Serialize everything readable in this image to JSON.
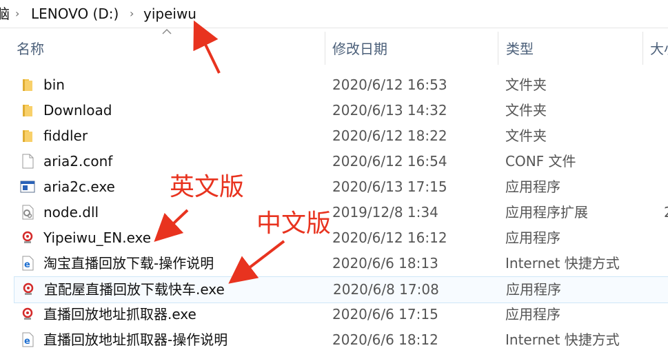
{
  "breadcrumb": {
    "items": [
      "脑",
      "LENOVO (D:)",
      "yipeiwu"
    ]
  },
  "columns": {
    "name": "名称",
    "modified": "修改日期",
    "type": "类型",
    "size": "大小"
  },
  "files": [
    {
      "name": "bin",
      "modified": "2020/6/12 16:53",
      "type": "文件夹",
      "icon": "folder-icon"
    },
    {
      "name": "Download",
      "modified": "2020/6/13 14:32",
      "type": "文件夹",
      "icon": "folder-icon"
    },
    {
      "name": "fiddler",
      "modified": "2020/6/12 18:22",
      "type": "文件夹",
      "icon": "folder-icon"
    },
    {
      "name": "aria2.conf",
      "modified": "2020/6/12 16:54",
      "type": "CONF 文件",
      "icon": "document-icon"
    },
    {
      "name": "aria2c.exe",
      "modified": "2020/6/13 17:15",
      "type": "应用程序",
      "icon": "app-window-icon"
    },
    {
      "name": "node.dll",
      "modified": "2019/12/8 1:34",
      "type": "应用程序扩展",
      "icon": "dll-gear-icon",
      "extra": "2"
    },
    {
      "name": "Yipeiwu_EN.exe",
      "modified": "2020/6/12 16:12",
      "type": "应用程序",
      "icon": "red-app-icon"
    },
    {
      "name": "淘宝直播回放下载-操作说明",
      "modified": "2020/6/6 18:13",
      "type": "Internet 快捷方式",
      "icon": "internet-shortcut-icon"
    },
    {
      "name": "宜配屋直播回放下载快车.exe",
      "modified": "2020/6/8 17:08",
      "type": "应用程序",
      "icon": "red-app-icon",
      "selected": true
    },
    {
      "name": "直播回放地址抓取器.exe",
      "modified": "2020/6/6 17:15",
      "type": "应用程序",
      "icon": "red-app-icon"
    },
    {
      "name": "直播回放地址抓取器-操作说明",
      "modified": "2020/6/6 18:12",
      "type": "Internet 快捷方式",
      "icon": "internet-shortcut-icon"
    }
  ],
  "annotations": {
    "english": "英文版",
    "chinese": "中文版"
  },
  "colors": {
    "annotation": "#e8331f",
    "folder": "#f6c64b",
    "header_text": "#4c607a",
    "selection_border": "#cfe6f7"
  }
}
